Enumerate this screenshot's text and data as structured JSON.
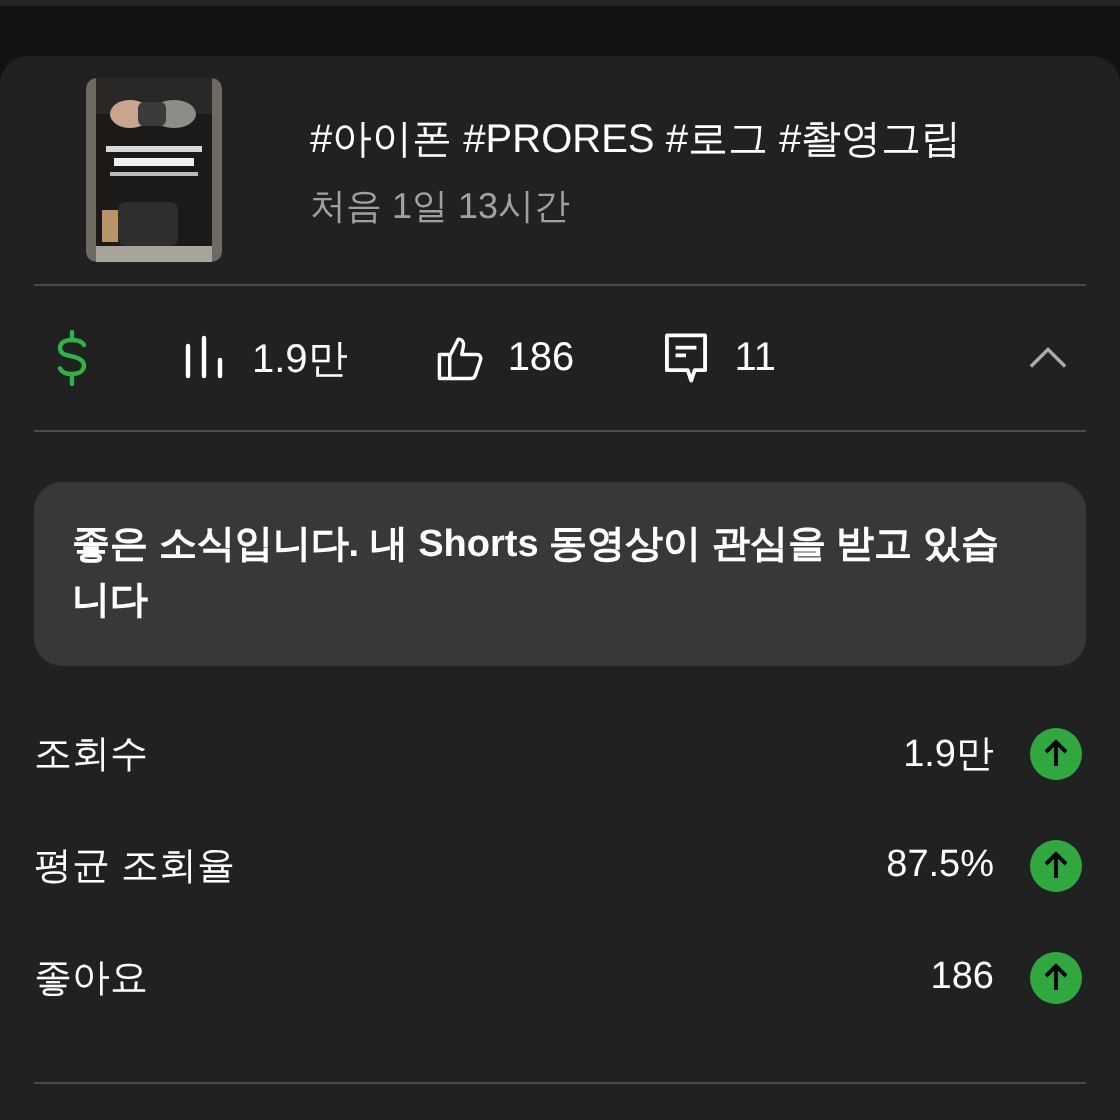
{
  "video": {
    "title": "#아이폰 #PRORES #로그 #촬영그립",
    "subtitle": "처음 1일 13시간"
  },
  "stats": [
    {
      "kind": "views",
      "value": "1.9만"
    },
    {
      "kind": "likes",
      "value": "186"
    },
    {
      "kind": "comments",
      "value": "11"
    }
  ],
  "banner": {
    "text": "좋은 소식입니다. 내 Shorts 동영상이 관심을 받고 있습니다"
  },
  "metrics": [
    {
      "label": "조회수",
      "value": "1.9만"
    },
    {
      "label": "평균 조회율",
      "value": "87.5%"
    },
    {
      "label": "좋아요",
      "value": "186"
    }
  ]
}
